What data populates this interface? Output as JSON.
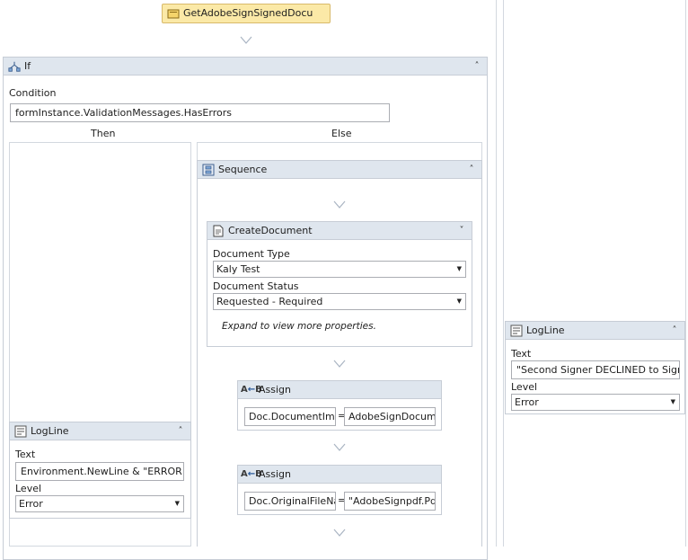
{
  "top_activity": {
    "label": "GetAdobeSignSignedDocu"
  },
  "if_activity": {
    "title": "If",
    "condition_label": "Condition",
    "condition_value": "formInstance.ValidationMessages.HasErrors",
    "then_label": "Then",
    "else_label": "Else"
  },
  "then_logline": {
    "title": "LogLine",
    "text_label": "Text",
    "text_value": "Environment.NewLine & \"ERROR in",
    "level_label": "Level",
    "level_value": "Error"
  },
  "sequence": {
    "title": "Sequence",
    "create_document": {
      "title": "CreateDocument",
      "doc_type_label": "Document Type",
      "doc_type_value": "Kaly Test",
      "doc_status_label": "Document Status",
      "doc_status_value": "Requested - Required",
      "expand_hint": "Expand to view more properties."
    },
    "assigns": [
      {
        "title": "Assign",
        "to": "Doc.DocumentIma",
        "eq": "=",
        "value": "AdobeSignDocume"
      },
      {
        "title": "Assign",
        "to": "Doc.OriginalFileNa",
        "eq": "=",
        "value": "\"AdobeSignpdf.Pd"
      }
    ]
  },
  "right_logline": {
    "title": "LogLine",
    "text_label": "Text",
    "text_value": "\"Second Signer DECLINED to Sign -",
    "level_label": "Level",
    "level_value": "Error"
  },
  "icons": {
    "collapse": "double-chevron-up",
    "expand": "double-chevron-down",
    "dropdown": "triangle-down"
  }
}
